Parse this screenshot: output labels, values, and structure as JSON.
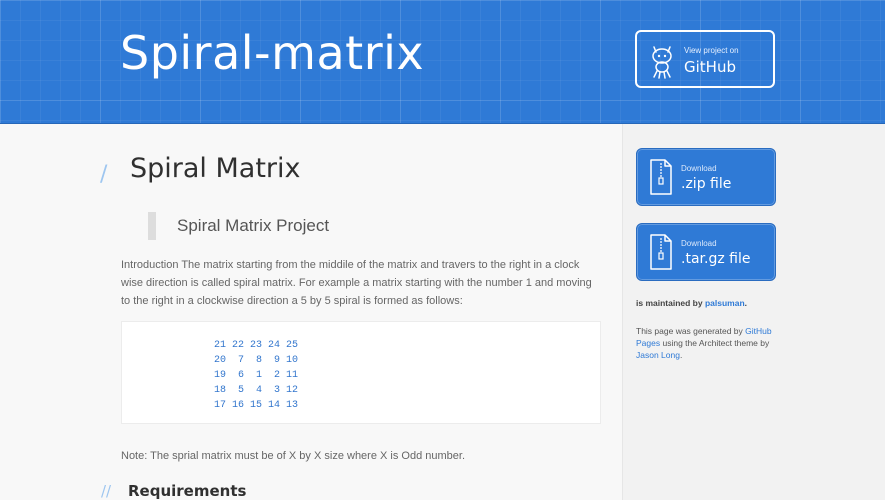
{
  "header": {
    "title": "Spiral-matrix",
    "github_button": {
      "small": "View project on",
      "big": "GitHub"
    }
  },
  "main": {
    "heading": "Spiral Matrix",
    "blockquote": "Spiral Matrix Project",
    "intro": "Introduction The matrix starting from the middile of the matrix and travers to the right in a clock wise direction is called spiral matrix. For example a matrix starting with the number 1 and moving to the right in a clockwise direction a 5 by 5 spiral is formed as follows:",
    "code": "21 22 23 24 25\n20  7  8  9 10\n19  6  1  2 11\n18  5  4  3 12\n17 16 15 14 13",
    "note": "Note: The sprial matrix must be of X by X size where X is Odd number.",
    "requirements_heading": "Requirements"
  },
  "sidebar": {
    "zip": {
      "small": "Download",
      "big": ".zip file"
    },
    "tgz": {
      "small": "Download",
      "big": ".tar.gz file"
    },
    "maintained_prefix": "is maintained by ",
    "maintainer": "palsuman",
    "maintained_suffix": ".",
    "generated_prefix": "This page was generated by ",
    "generated_link": "GitHub Pages",
    "generated_middle": " using the Architect theme by ",
    "author_link": "Jason Long",
    "generated_suffix": "."
  },
  "colors": {
    "brand_blue": "#2f7ad6",
    "link_blue": "#2f7ad6",
    "code_blue": "#3276cd"
  }
}
